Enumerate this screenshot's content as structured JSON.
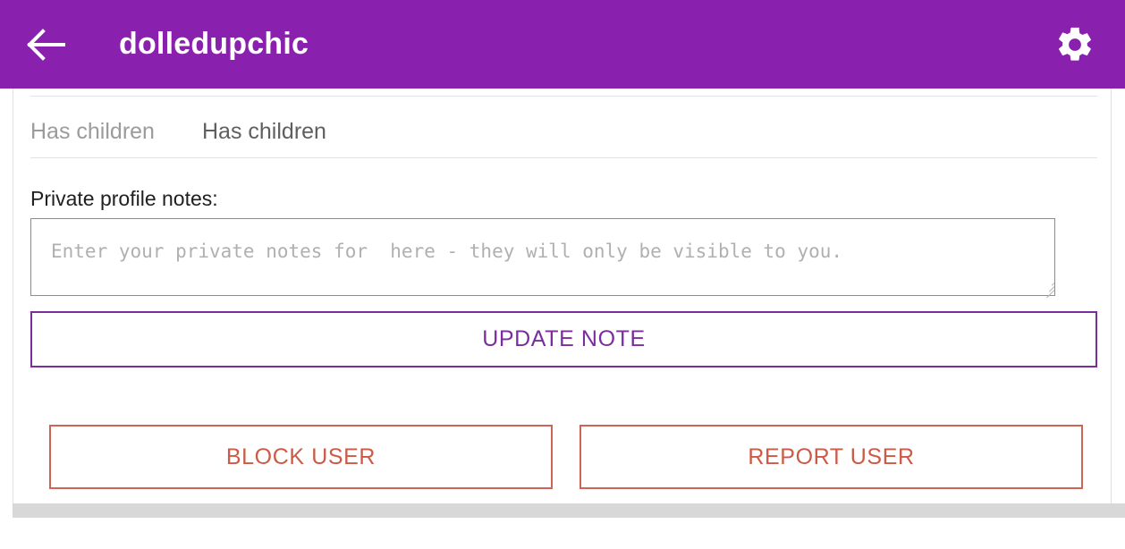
{
  "appbar": {
    "back_icon": "arrow-left-icon",
    "title": "dolledupchic",
    "settings_icon": "gear-icon",
    "background_color": "#8A20AE",
    "text_color": "#FFFFFF"
  },
  "profile": {
    "attributes": [
      {
        "label": "Has children",
        "value": "Has children"
      }
    ]
  },
  "notes": {
    "label": "Private profile notes:",
    "placeholder": "Enter your private notes for  here - they will only be visible to you.",
    "value": "",
    "update_button": "UPDATE NOTE",
    "update_button_color": "#7B2D9E"
  },
  "actions": {
    "block_button": "BLOCK USER",
    "report_button": "REPORT USER",
    "danger_color": "#CC5A46"
  }
}
